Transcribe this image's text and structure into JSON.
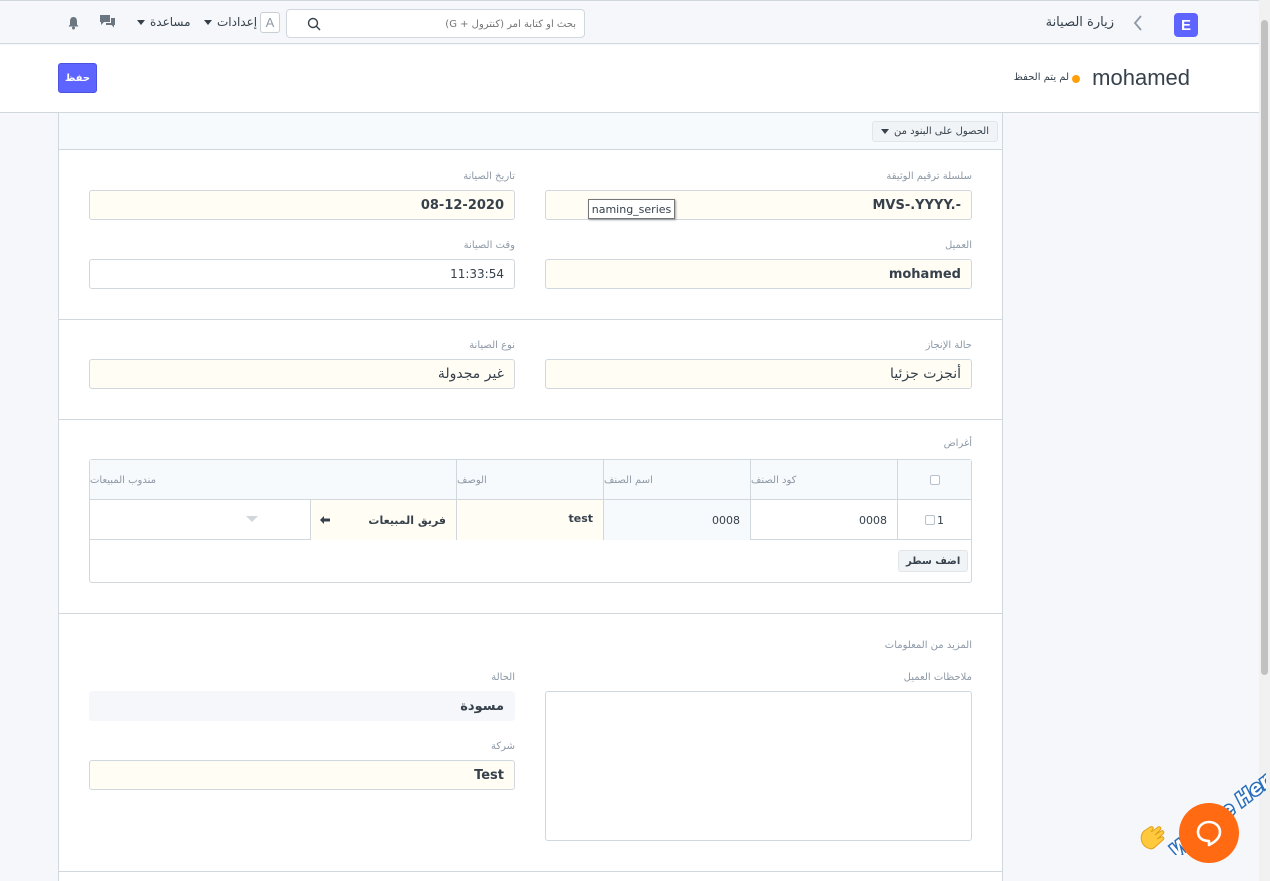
{
  "navbar": {
    "logo_letter": "E",
    "breadcrumb": "زيارة الصيانة",
    "search_placeholder": "بحث أو كتابة أمر (كنترول + G)",
    "avatar_letter": "A",
    "settings_label": "إعدادات",
    "help_label": "مساعدة"
  },
  "page_head": {
    "title": "mohamed",
    "status": "لم يتم الحفظ",
    "save_label": "حفظ"
  },
  "toolbar": {
    "get_items_label": "الحصول على البنود من"
  },
  "fields": {
    "naming_series": {
      "label": "سلسلة ترقيم الوثيقة",
      "value": "MVS-.YYYY.-",
      "tooltip": "naming_series"
    },
    "maintenance_date": {
      "label": "تاريخ الصيانة",
      "value": "08-12-2020"
    },
    "customer": {
      "label": "العميل",
      "value": "mohamed"
    },
    "maintenance_time": {
      "label": "وقت الصيانة",
      "value": "11:33:54"
    },
    "completion_status": {
      "label": "حالة الإنجاز",
      "value": "أنجزت جزئيا"
    },
    "maintenance_type": {
      "label": "نوع الصيانة",
      "value": "غير مجدولة"
    }
  },
  "purposes": {
    "label": "أغراض",
    "columns": [
      "كود الصنف",
      "اسم الصنف",
      "الوصف",
      "مندوب المبيعات"
    ],
    "rows": [
      {
        "idx": "1",
        "item_code": "0008",
        "item_name": "0008",
        "description": "test",
        "sales_person": "فريق المبيعات"
      }
    ],
    "add_row_label": "اضف سطر"
  },
  "more_info": {
    "section_label": "المزيد من المعلومات",
    "customer_notes_label": "ملاحظات العميل",
    "status_label": "الحالة",
    "status_value": "مسودة",
    "company_label": "شركة",
    "company_value": "Test"
  },
  "chat_widget": {
    "banner_text": "We Are Here!"
  },
  "colors": {
    "primary": "#5e64ff",
    "unsaved": "#ffa00a",
    "chat": "#ff6a13"
  }
}
